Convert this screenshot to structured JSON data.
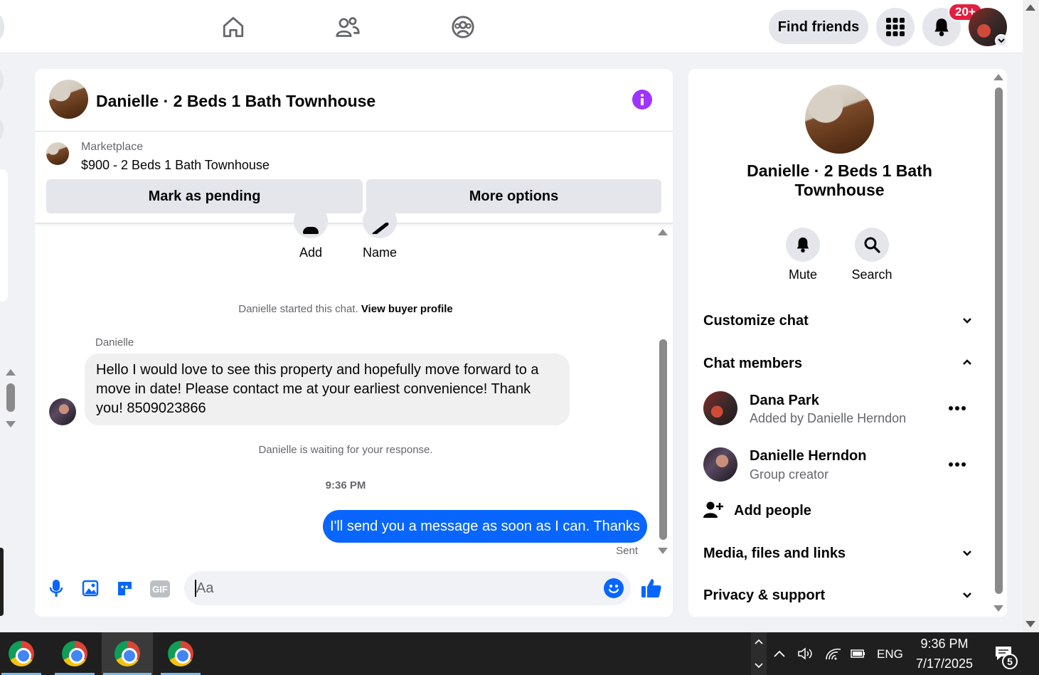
{
  "header": {
    "find_friends": "Find friends",
    "notification_count": "20+",
    "icons": [
      "home-icon",
      "friends-icon",
      "groups-icon",
      "menu-grid-icon",
      "bell-icon"
    ]
  },
  "chat": {
    "title": "Danielle · 2 Beds 1 Bath Townhouse",
    "marketplace_label": "Marketplace",
    "listing": "$900 - 2 Beds 1 Bath Townhouse",
    "mark_pending": "Mark as pending",
    "more_options": "More options",
    "add_label": "Add",
    "name_label": "Name",
    "started_text": "Danielle started this chat.",
    "view_buyer": "View buyer profile",
    "sender_name": "Danielle",
    "incoming_message": "Hello I would love to see this property and hopefully move forward to a move in date! Please contact me at your earliest convenience! Thank you! 8509023866",
    "waiting_text": "Danielle is waiting for your response.",
    "timestamp": "9:36 PM",
    "outgoing_message": "I'll send you a message as soon as I can. Thanks",
    "sent_label": "Sent",
    "input_placeholder": "Aa",
    "accent_color": "#0866ff"
  },
  "details": {
    "title": "Danielle · 2 Beds 1 Bath Townhouse",
    "mute": "Mute",
    "search": "Search",
    "customize_chat": "Customize chat",
    "chat_members": "Chat members",
    "members": [
      {
        "name": "Dana Park",
        "sub": "Added by Danielle Herndon"
      },
      {
        "name": "Danielle Herndon",
        "sub": "Group creator"
      }
    ],
    "add_people": "Add people",
    "media_files": "Media, files and links",
    "privacy_support": "Privacy & support"
  },
  "taskbar": {
    "lang": "ENG",
    "time": "9:36 PM",
    "date": "7/17/2025",
    "notif_count": "5"
  }
}
